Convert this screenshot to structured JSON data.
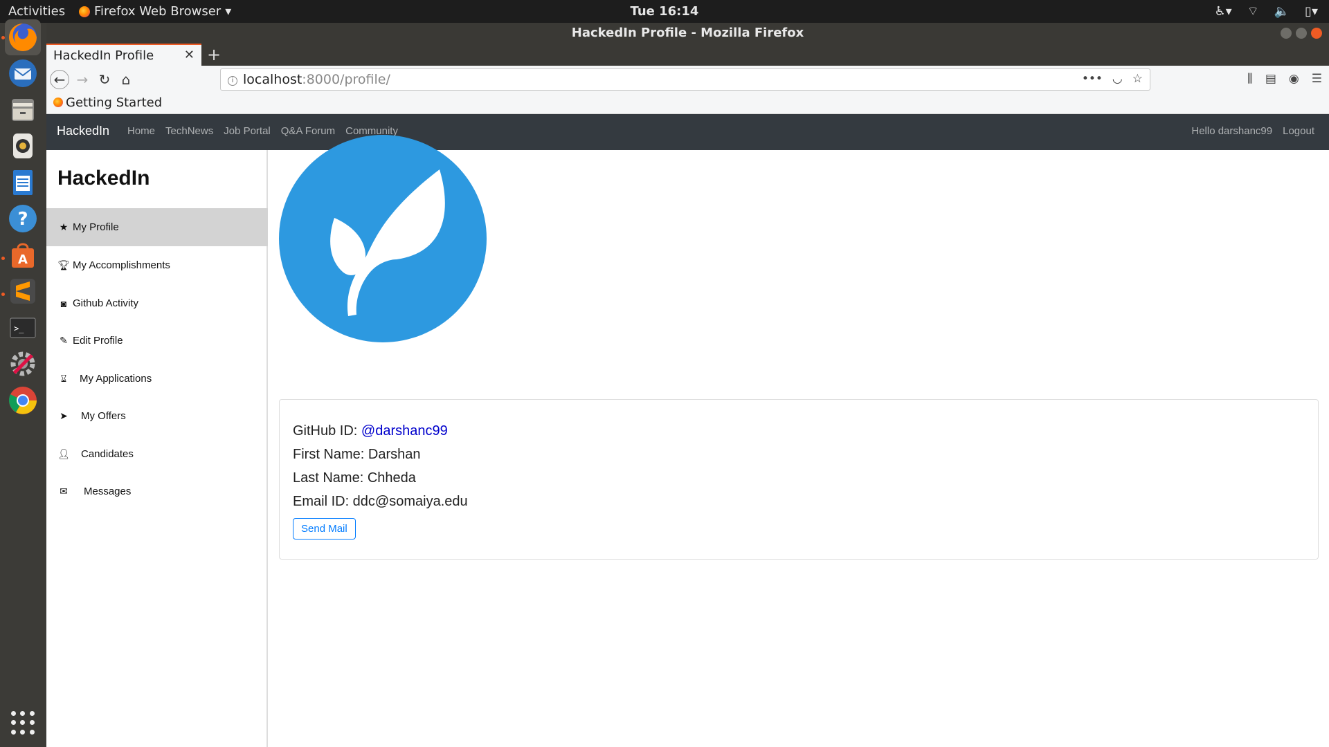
{
  "topbar": {
    "activities": "Activities",
    "app_menu": "Firefox Web Browser",
    "clock": "Tue 16:14"
  },
  "window": {
    "title": "HackedIn Profile - Mozilla Firefox"
  },
  "tabs": [
    {
      "label": "HackedIn Profile"
    }
  ],
  "navbar": {
    "url_host": "localhost",
    "url_path": ":8000/profile/"
  },
  "bookmarks": [
    {
      "label": "Getting Started"
    }
  ],
  "site": {
    "brand": "HackedIn",
    "links": [
      "Home",
      "TechNews",
      "Job Portal",
      "Q&A Forum",
      "Community"
    ],
    "greeting": "Hello darshanc99",
    "logout": "Logout"
  },
  "sidebar": {
    "title": "HackedIn",
    "items": [
      {
        "label": "My Profile",
        "icon": "star-icon"
      },
      {
        "label": "My Accomplishments",
        "icon": "trophy-icon"
      },
      {
        "label": "Github Activity",
        "icon": "github-icon"
      },
      {
        "label": "Edit Profile",
        "icon": "pencil-icon"
      },
      {
        "label": "My Applications",
        "icon": "hourglass-icon"
      },
      {
        "label": "My Offers",
        "icon": "send-icon"
      },
      {
        "label": "Candidates",
        "icon": "user-icon"
      },
      {
        "label": "Messages",
        "icon": "envelope-icon"
      }
    ]
  },
  "profile": {
    "github_label": "GitHub ID: ",
    "github_id": "@darshanc99",
    "first_name": "First Name: Darshan",
    "last_name": "Last Name: Chheda",
    "email": "Email ID: ddc@somaiya.edu",
    "send_mail": "Send Mail"
  },
  "colors": {
    "avatar_bg": "#2d99e0",
    "nav_bg": "#343a40",
    "active_item": "#d3d3d3",
    "button_blue": "#007bff"
  }
}
